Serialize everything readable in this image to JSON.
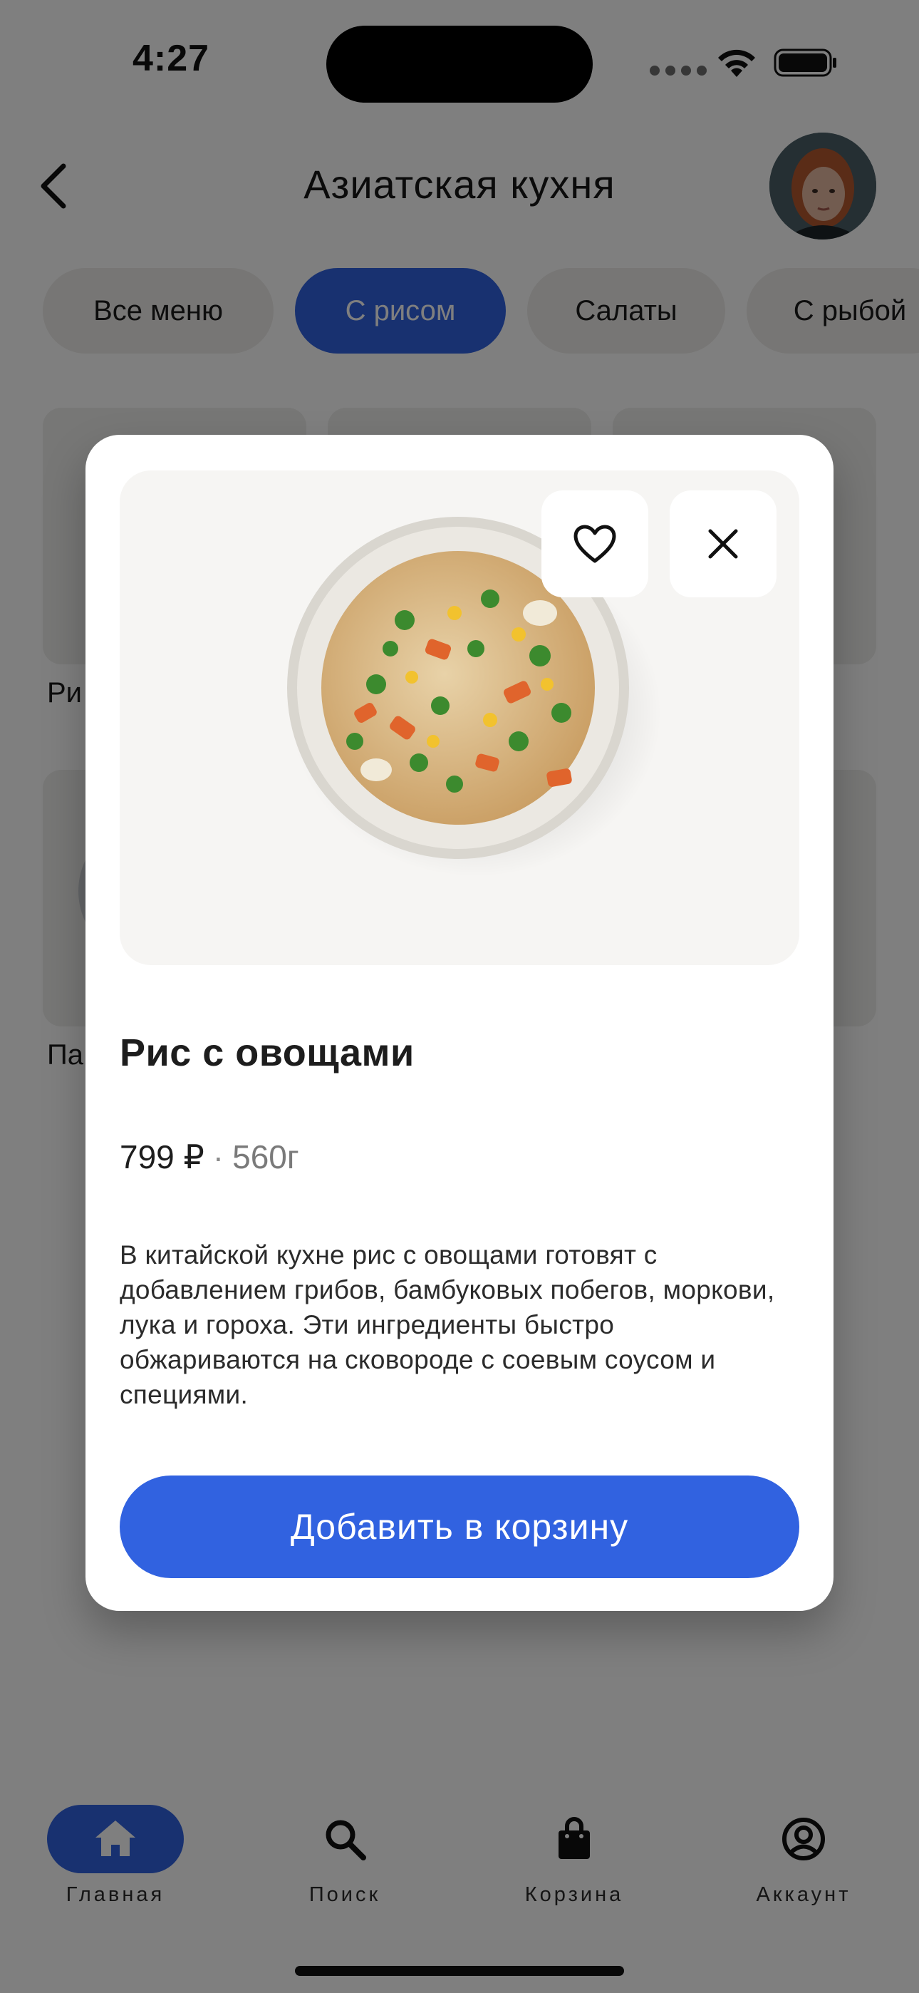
{
  "status_bar": {
    "time": "4:27"
  },
  "header": {
    "title": "Азиатская кухня",
    "back_icon": "chevron-left-icon",
    "avatar": "user-avatar"
  },
  "categories": {
    "items": [
      {
        "label": "Все меню",
        "active": false
      },
      {
        "label": "С рисом",
        "active": true
      },
      {
        "label": "Салаты",
        "active": false
      },
      {
        "label": "С рыбой",
        "active": false
      }
    ]
  },
  "background_cards": {
    "labels": [
      "Ри",
      "Па"
    ]
  },
  "modal": {
    "dish_name": "Рис с овощами",
    "price": "799 ₽",
    "separator": "·",
    "weight": "560г",
    "description": "В китайской кухне рис с овощами готовят с добавлением грибов, бамбуковых побегов, моркови, лука и гороха. Эти ингредиенты быстро обжариваются на сковороде с соевым соусом и специями.",
    "add_to_cart_label": "Добавить в корзину",
    "favorite_icon": "heart-icon",
    "close_icon": "close-icon"
  },
  "bottom_nav": {
    "items": [
      {
        "label": "Главная",
        "icon": "home-icon",
        "active": true
      },
      {
        "label": "Поиск",
        "icon": "search-icon",
        "active": false
      },
      {
        "label": "Корзина",
        "icon": "bag-icon",
        "active": false
      },
      {
        "label": "Аккаунт",
        "icon": "account-icon",
        "active": false
      }
    ]
  },
  "colors": {
    "accent": "#3162e0",
    "overlay": "rgba(0,0,0,0.5)",
    "chip_bg": "#eeedea"
  }
}
